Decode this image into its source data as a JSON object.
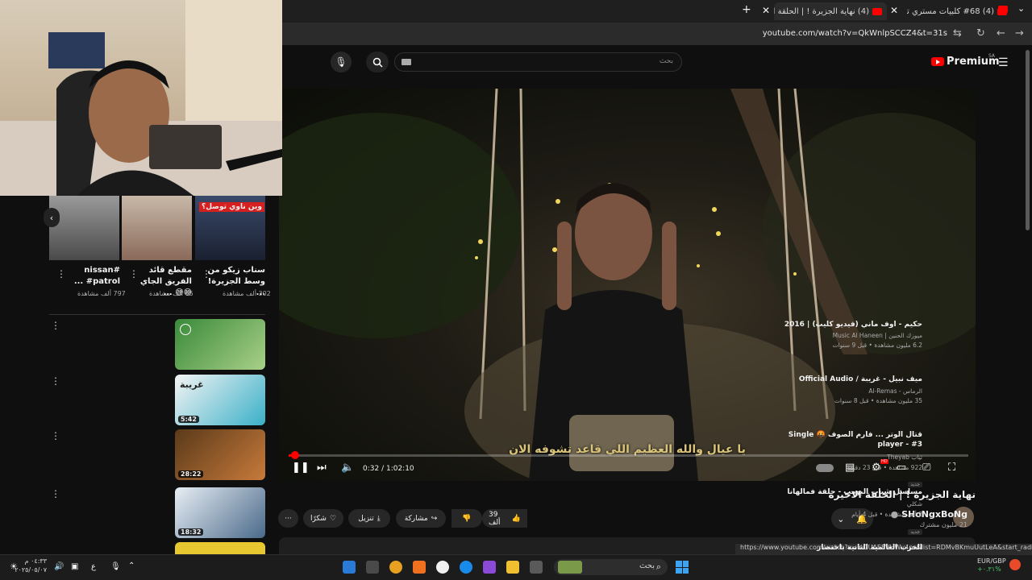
{
  "browser": {
    "tabs": [
      {
        "label": "(4) #68 كلبيات مستري تاون MT",
        "active": false
      },
      {
        "label": "(4) نهاية الجزيرة ! | الحلقة الاخ",
        "active": true
      }
    ],
    "new_tab_icon": "plus-icon",
    "url": "youtube.com/watch?v=QkWnlpSCCZ4&t=31s"
  },
  "youtube": {
    "logo_text": "Premium",
    "country_code": "SA",
    "search_placeholder": "بحث",
    "search_value": "",
    "colors": {
      "brand": "#ff0000",
      "subtitle": "#d9c47a"
    }
  },
  "player": {
    "subtitle": "يا عيال والله العظيم اللي قاعد تشوفه الان",
    "current_time": "0:32",
    "duration": "1:02:10",
    "time_display": "0:32 / 1:02:10",
    "progress_fraction": 0.0086,
    "settings_badge": "HD"
  },
  "video": {
    "title": "نهاية الجزيرة ! | الحلقة الاخيرة",
    "channel": "SHoNgxBoNg",
    "subscribers": "21 مليون مشترك",
    "likes": "39 ألف",
    "share_label": "مشاركة",
    "download_label": "تنزيل",
    "thanks_label": "شكرًا"
  },
  "shorts": [
    {
      "title": "nissan# #patrol ...",
      "views": "797 ألف مشاهدة"
    },
    {
      "title": "مقطع قائد الفريق الجاي 😅😅 ...",
      "views": "65 ألف مشاهدة"
    },
    {
      "title": "سناب زيكو من وسط الجزيرة! ...",
      "views": "302 ألف مشاهدة",
      "thumb_text": "وين ناوي توصل؟"
    }
  ],
  "recommendations": [
    {
      "title": "حكيم - اوف ماني (فيديو كليب) | 2016",
      "channel": "ميوزك الحنين | Music Al Haneen",
      "meta": "6.2 مليون مشاهدة • قبل 9 سنوات",
      "duration": ""
    },
    {
      "title": "ميف نبيل - غريبة / Official Audio",
      "channel": "الرماس - Al-Remas",
      "meta": "35 مليون مشاهدة • قبل 8 سنوات",
      "duration": "5:42",
      "thumb_text": "غريبة"
    },
    {
      "title": "قتال الوتر ... فارم الصوف 🤬 Single player - #3",
      "channel": "ثياب Theyab",
      "meta": "922 مشاهدة • قبل 23 دقيقة",
      "duration": "28:22",
      "badge": "جديد"
    },
    {
      "title": "مسلسل شباب البومب - حلقة فمالهانا",
      "channel": "شكلي",
      "meta": "2 ألف مشاهدة • قبل 4 أيام",
      "duration": "18:32",
      "badge": "جديد"
    },
    {
      "title": "الحرب العالمية الثانية باختصار",
      "channel": "",
      "meta": "",
      "duration": ""
    }
  ],
  "status_url": "https://www.youtube.com/watch?v=inGUAEEVHWv4ns&list=RDMvBKmuUutLeA&start_radio=1&pp=oAcB",
  "taskbar": {
    "search_label": "بحث",
    "time": "٠٤:٣٣ م",
    "date": "٢٠٢٥/٠٥/٠٧",
    "keyboard_lang": "ع",
    "currency_pair": "EUR/GBP",
    "currency_change": "+٠.٣١%"
  }
}
